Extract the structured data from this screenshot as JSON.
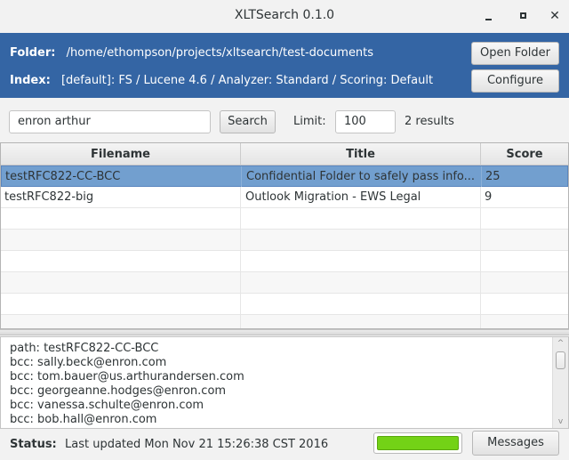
{
  "window": {
    "title": "XLTSearch 0.1.0",
    "controls": {
      "minimize": "_",
      "maximize": "□",
      "close": "✕"
    }
  },
  "header": {
    "folder_label": "Folder:",
    "folder_value": "/home/ethompson/projects/xltsearch/test-documents",
    "index_label": "Index:",
    "index_value": "[default]: FS / Lucene 4.6 / Analyzer: Standard / Scoring: Default",
    "open_folder_label": "Open Folder",
    "configure_label": "Configure",
    "bg_color": "#3465a4"
  },
  "search": {
    "query": "enron arthur",
    "search_label": "Search",
    "limit_label": "Limit:",
    "limit_value": "100",
    "results_count": "2 results"
  },
  "table": {
    "columns": [
      "Filename",
      "Title",
      "Score"
    ],
    "rows": [
      {
        "filename": "testRFC822-CC-BCC",
        "title": "Confidential Folder to safely pass info...",
        "score": "25",
        "selected": true
      },
      {
        "filename": "testRFC822-big",
        "title": "Outlook Migration - EWS Legal",
        "score": "9",
        "selected": false
      }
    ],
    "selection_color": "#729fcf"
  },
  "detail": {
    "lines": [
      "path: testRFC822-CC-BCC",
      "bcc: sally.beck@enron.com",
      "bcc: tom.bauer@us.arthurandersen.com",
      "bcc: georgeanne.hodges@enron.com",
      "bcc: vanessa.schulte@enron.com",
      "bcc: bob.hall@enron.com"
    ],
    "scroll_up_icon": "^",
    "scroll_down_icon": "v"
  },
  "status": {
    "label": "Status:",
    "text": "Last updated Mon Nov 21 15:26:38 CST 2016",
    "progress_percent": 100,
    "progress_color": "#73d216",
    "messages_label": "Messages"
  }
}
